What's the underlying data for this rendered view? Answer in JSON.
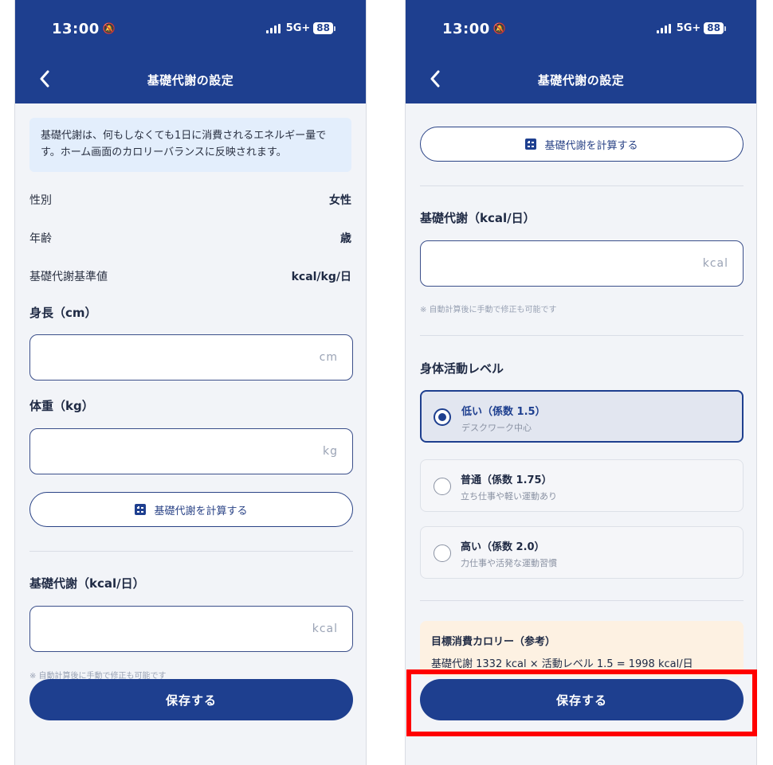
{
  "colors": {
    "header": "#1e3f8f",
    "primary": "#1e3f8f",
    "highlight": "#ff0000",
    "info_bg": "#e3eefc",
    "target_bg": "#fdf1e2"
  },
  "status": {
    "time": "13:00",
    "network": "5G+",
    "battery": "88"
  },
  "screen_title": "基礎代謝の設定",
  "left": {
    "info": "基礎代謝は、何もしなくても1日に消費されるエネルギー量です。ホーム画面のカロリーバランスに反映されます。",
    "rows": [
      {
        "label": "性別",
        "value": "女性"
      },
      {
        "label": "年齢",
        "value": "歳"
      },
      {
        "label": "基礎代謝基準値",
        "value": "kcal/kg/日"
      }
    ],
    "height": {
      "label": "身長（cm）",
      "placeholder": "cm"
    },
    "weight": {
      "label": "体重（kg）",
      "placeholder": "kg"
    },
    "calc_button": "基礎代謝を計算する",
    "bmr": {
      "label": "基礎代謝（kcal/日）",
      "placeholder": "kcal"
    },
    "note": "※ 自動計算後に手動で修正も可能です",
    "save_button": "保存する"
  },
  "right": {
    "calc_button": "基礎代謝を計算する",
    "bmr": {
      "label": "基礎代謝（kcal/日）",
      "placeholder": "kcal"
    },
    "note": "※ 自動計算後に手動で修正も可能です",
    "activity_title": "身体活動レベル",
    "options": [
      {
        "title": "低い（係数 1.5）",
        "sub": "デスクワーク中心",
        "selected": true
      },
      {
        "title": "普通（係数 1.75）",
        "sub": "立ち仕事や軽い運動あり",
        "selected": false
      },
      {
        "title": "高い（係数 2.0）",
        "sub": "力仕事や活発な運動習慣",
        "selected": false
      }
    ],
    "target": {
      "title": "目標消費カロリー（参考）",
      "formula": "基礎代謝 1332 kcal × 活動レベル 1.5 = 1998 kcal/日"
    },
    "save_button": "保存する"
  },
  "icons": {
    "back": "chevron-left-icon",
    "bell": "bell-slash-icon",
    "calc": "calculator-icon",
    "signal": "signal-bars-icon",
    "battery": "battery-icon"
  }
}
